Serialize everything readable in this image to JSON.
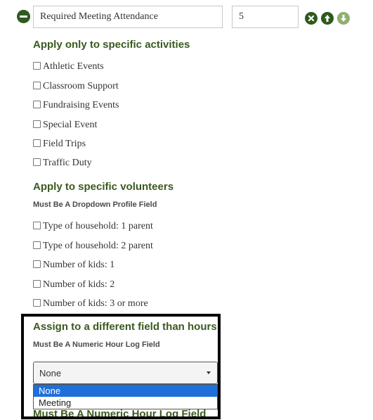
{
  "rule": {
    "name": "Required Meeting Attendance",
    "value": "5"
  },
  "controls": {
    "remove_icon": "minus-circle",
    "delete_icon": "x-circle",
    "move_up_icon": "arrow-up-circle",
    "move_down_icon": "arrow-down-circle",
    "dark_green": "#2e5a1f",
    "light_green": "#8fb070"
  },
  "activities": {
    "title": "Apply only to specific activities",
    "items": [
      {
        "label": "Athletic Events",
        "checked": false
      },
      {
        "label": "Classroom Support",
        "checked": false
      },
      {
        "label": "Fundraising Events",
        "checked": false
      },
      {
        "label": "Special Event",
        "checked": false
      },
      {
        "label": "Field Trips",
        "checked": false
      },
      {
        "label": "Traffic Duty",
        "checked": false
      }
    ]
  },
  "volunteers": {
    "title": "Apply to specific volunteers",
    "subtitle": "Must Be A Dropdown Profile Field",
    "items": [
      {
        "label": "Type of household: 1 parent",
        "checked": false
      },
      {
        "label": "Type of household: 2 parent",
        "checked": false
      },
      {
        "label": "Number of kids: 1",
        "checked": false
      },
      {
        "label": "Number of kids: 2",
        "checked": false
      },
      {
        "label": "Number of kids: 3 or more",
        "checked": false
      }
    ]
  },
  "assign_field": {
    "title": "Assign to a different field than hours",
    "subtitle": "Must Be A Numeric Hour Log Field",
    "selected": "None",
    "options": [
      "None",
      "Meeting"
    ]
  },
  "next_section_peek": "Must Be A Numeric Hour Log Field"
}
